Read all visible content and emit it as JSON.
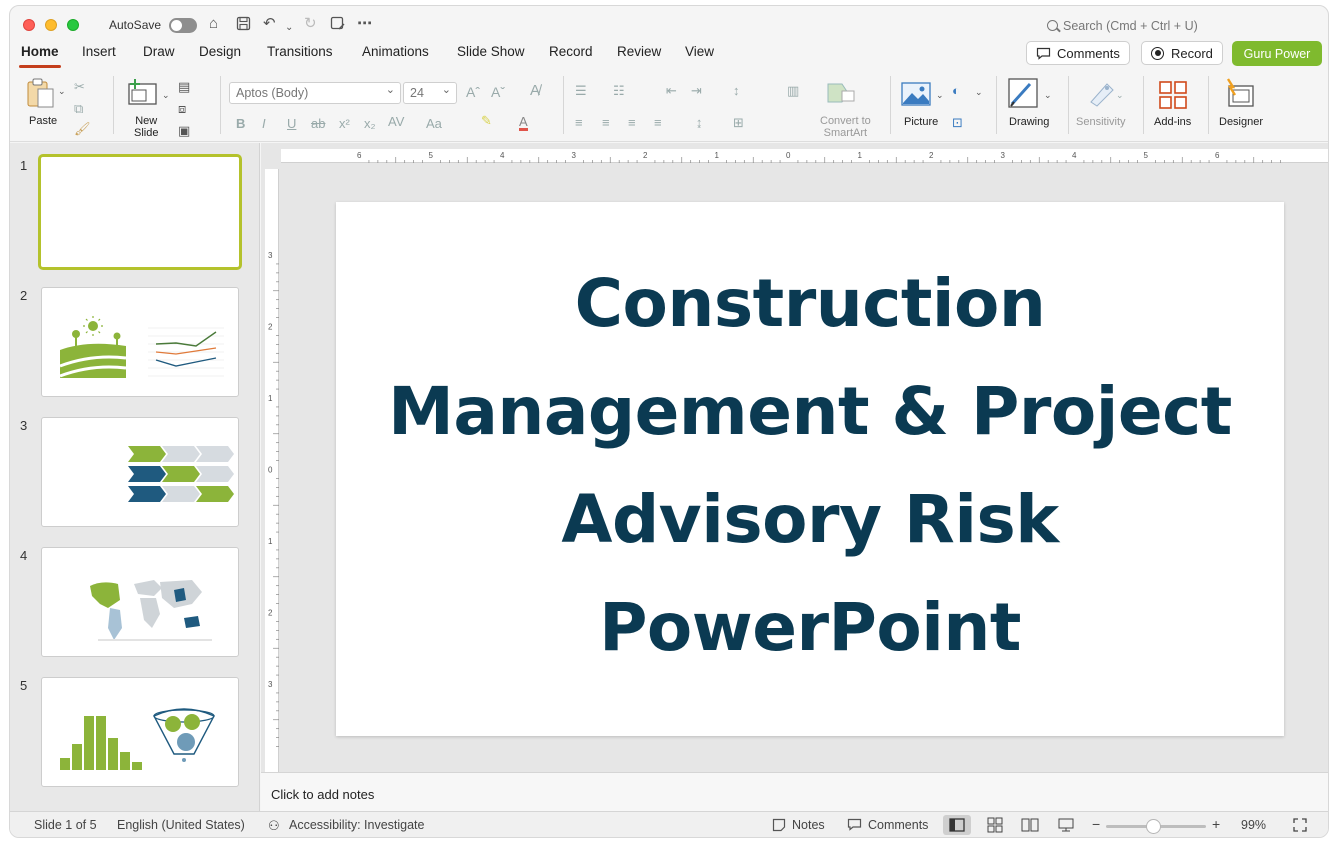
{
  "titlebar": {
    "autosave_label": "AutoSave",
    "search_placeholder": "Search (Cmd + Ctrl + U)"
  },
  "tabs": [
    "Home",
    "Insert",
    "Draw",
    "Design",
    "Transitions",
    "Animations",
    "Slide Show",
    "Record",
    "Review",
    "View"
  ],
  "header_buttons": {
    "comments": "Comments",
    "record": "Record",
    "guru": "Guru Power"
  },
  "ribbon": {
    "paste": "Paste",
    "new_slide": "New\nSlide",
    "font_name": "Aptos (Body)",
    "font_size": "24",
    "convert_smartart": "Convert to\nSmartArt",
    "picture": "Picture",
    "drawing": "Drawing",
    "sensitivity": "Sensitivity",
    "addins": "Add-ins",
    "designer": "Designer"
  },
  "slides": [
    {
      "num": "1"
    },
    {
      "num": "2"
    },
    {
      "num": "3"
    },
    {
      "num": "4"
    },
    {
      "num": "5"
    }
  ],
  "slide_title_lines": [
    "Construction",
    "Management & Project",
    "Advisory Risk",
    "PowerPoint"
  ],
  "notes_placeholder": "Click to add notes",
  "status": {
    "slide_count": "Slide 1 of 5",
    "language": "English (United States)",
    "accessibility": "Accessibility: Investigate",
    "notes": "Notes",
    "comments": "Comments",
    "zoom": "99%"
  },
  "colors": {
    "title": "#0b3a52",
    "accent_green": "#8cb43a",
    "accent_blue": "#1f5a7f",
    "tab_underline": "#c43e1c"
  },
  "rulers": {
    "horizontal_ticks": [
      "6",
      "5",
      "4",
      "3",
      "2",
      "1",
      "0",
      "1",
      "2",
      "3",
      "4",
      "5",
      "6"
    ],
    "vertical_ticks": [
      "3",
      "2",
      "1",
      "0",
      "1",
      "2",
      "3"
    ]
  }
}
